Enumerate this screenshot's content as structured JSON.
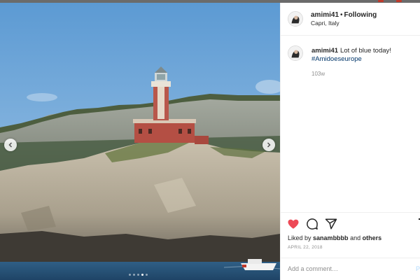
{
  "post": {
    "username": "amimi41",
    "separator": "•",
    "follow_status": "Following",
    "location": "Capri, Italy"
  },
  "caption": {
    "username": "amimi41",
    "text": "Lot of blue today!",
    "hashtag": "#Amidoeseurope",
    "age": "103w"
  },
  "engagement": {
    "liked_by_prefix": "Liked by",
    "liked_by_user": "sanambbbb",
    "liked_by_and": "and",
    "liked_by_others": "others",
    "date": "APRIL 22, 2018"
  },
  "comment_box": {
    "placeholder": "Add a comment…",
    "post_label": "P"
  },
  "carousel": {
    "total": 5,
    "current": 4
  },
  "colors": {
    "heart": "#ed4956",
    "hashtag": "#003569",
    "muted": "#8e8e8e",
    "post_button": "#b3dbff"
  },
  "icons": {
    "like": "heart-icon",
    "comment": "comment-icon",
    "share": "share-icon",
    "save": "bookmark-icon",
    "prev": "chevron-left-icon",
    "next": "chevron-right-icon"
  }
}
